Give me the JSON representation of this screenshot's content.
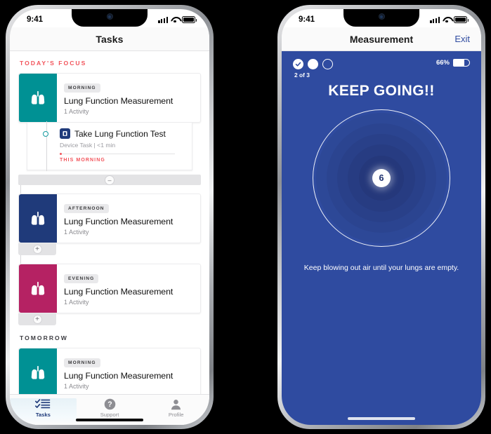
{
  "colors": {
    "teal": "#009194",
    "navy": "#1f3a7a",
    "magenta": "#b52263",
    "royal_blue": "#2f4ba0",
    "accent_red": "#f2545b"
  },
  "phone_left": {
    "status_bar": {
      "time": "9:41",
      "signal_icon": "cellular-signal-icon",
      "wifi_icon": "wifi-icon",
      "battery_icon": "battery-icon"
    },
    "nav": {
      "title": "Tasks"
    },
    "sections": [
      {
        "header": "TODAY'S FOCUS",
        "cards": [
          {
            "chip": "MORNING",
            "title": "Lung Function Measurement",
            "subtitle": "1 Activity",
            "thumb_color": "#009194",
            "expanded": true,
            "task": {
              "title": "Take Lung Function Test",
              "meta": "Device Task | <1 min",
              "due": "THIS MORNING"
            }
          },
          {
            "chip": "AFTERNOON",
            "title": "Lung Function Measurement",
            "subtitle": "1 Activity",
            "thumb_color": "#1f3a7a",
            "expanded": false
          },
          {
            "chip": "EVENING",
            "title": "Lung Function Measurement",
            "subtitle": "1 Activity",
            "thumb_color": "#b52263",
            "expanded": false
          }
        ]
      },
      {
        "header": "TOMORROW",
        "cards": [
          {
            "chip": "MORNING",
            "title": "Lung Function Measurement",
            "subtitle": "1 Activity",
            "thumb_color": "#009194",
            "expanded": false
          }
        ]
      }
    ],
    "buttons": {
      "collapse": "–",
      "expand": "+"
    },
    "tabbar": [
      {
        "label": "Tasks",
        "icon": "checklist-icon",
        "active": true
      },
      {
        "label": "Support",
        "icon": "question-circle-icon",
        "active": false
      },
      {
        "label": "Profile",
        "icon": "person-icon",
        "active": false
      }
    ]
  },
  "phone_right": {
    "status_bar": {
      "time": "9:41",
      "signal_icon": "cellular-signal-icon",
      "wifi_icon": "wifi-icon",
      "battery_icon": "battery-icon"
    },
    "nav": {
      "title": "Measurement",
      "exit": "Exit"
    },
    "progress": {
      "dots": [
        "done",
        "filled",
        "empty"
      ],
      "step_label": "2 of 3",
      "device_battery_pct": "66%",
      "device_battery_value": 66
    },
    "headline": "KEEP GOING!!",
    "counter": "6",
    "instruction": "Keep blowing out air until your lungs are empty."
  }
}
